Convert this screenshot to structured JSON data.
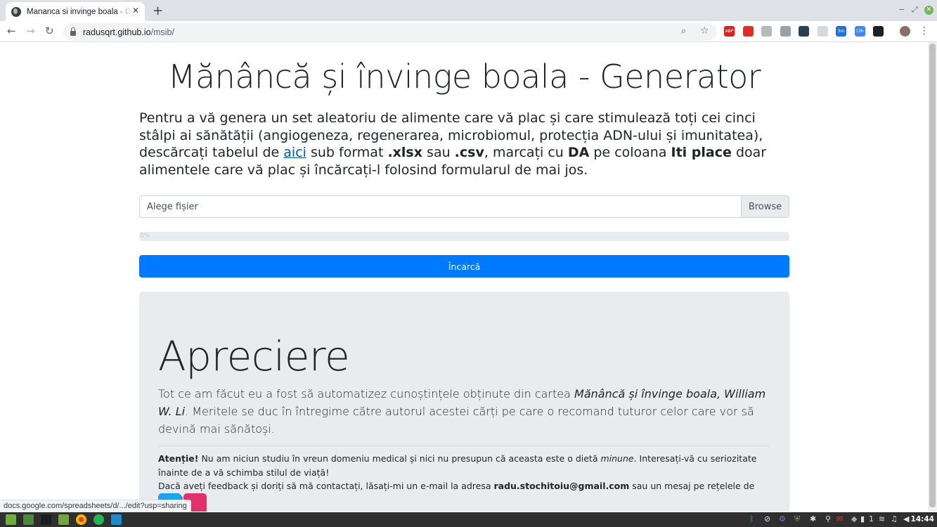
{
  "browser": {
    "tab_title": "Mananca si invinge boala - Generator",
    "tab_close": "✕",
    "new_tab": "+",
    "url_host": "radusqrt.github.io",
    "url_path": "/msib/",
    "back": "←",
    "forward": "→",
    "reload": "↻",
    "zoom_icon": "⌕",
    "star_icon": "☆",
    "menu_icon": "⋮",
    "win_minimize": "−",
    "win_restore": "⤢",
    "win_close": "✕",
    "extensions": [
      {
        "name": "adblock-plus-icon",
        "color": "#e0201f",
        "label": "ABP"
      },
      {
        "name": "youtube-icon",
        "color": "#e52d27",
        "label": ""
      },
      {
        "name": "extension-gray-icon",
        "color": "#b8b8b8",
        "label": ""
      },
      {
        "name": "cloud-icon",
        "color": "#9aa0a6",
        "label": ""
      },
      {
        "name": "extension-dark-icon",
        "color": "#2c3e50",
        "label": ""
      },
      {
        "name": "extension-light-icon",
        "color": "#d5d9dd",
        "label": ""
      },
      {
        "name": "timer-3m-icon",
        "color": "#1a73e8",
        "label": "3m"
      },
      {
        "name": "calendar-13h-icon",
        "color": "#4285f4",
        "label": "13h"
      },
      {
        "name": "notion-icon",
        "color": "#202124",
        "label": ""
      }
    ]
  },
  "page": {
    "title": "Mănâncă și învinge boala - Generator",
    "intro_1": "Pentru a vă genera un set aleatoriu de alimente care vă plac și care stimulează toți cei cinci stâlpi ai sănătății (angiogeneza, regenerarea, microbiomul, protecția ADN-ului și imunitatea), descărcați tabelul de ",
    "intro_link": "aici",
    "intro_2": " sub format ",
    "intro_xlsx": ".xlsx",
    "intro_3": " sau ",
    "intro_csv": ".csv",
    "intro_4": ", marcați cu ",
    "intro_da": "DA",
    "intro_5": " pe coloana ",
    "intro_col": "Iti place",
    "intro_6": " doar alimentele care vă plac și încărcați-l folosind formularul de mai jos.",
    "file_placeholder": "Alege fișier",
    "browse_label": "Browse",
    "progress_text": "0%",
    "progress_value": 0,
    "upload_label": "Încarcă",
    "appreciation": {
      "heading": "Apreciere",
      "lead_1": "Tot ce am făcut eu a fost să automatizez cunoștințele obținute din cartea ",
      "lead_book": "Mănâncă și învinge boala, William W. Li",
      "lead_2": ". Meritele se duc în întregime către autorul acestei cărți pe care o recomand tuturor celor care vor să devină mai sănătoși.",
      "warn_label": "Atenție!",
      "warn_1": " Nu am niciun studiu în vreun domeniu medical și nici nu presupun că aceasta este o dietă ",
      "warn_minune": "minune",
      "warn_2": ". Interesați-vă cu seriozitate înainte de a vă schimba stilul de viață!",
      "contact_1": "Dacă aveți feedback și doriți să mă contactați, lăsați-mi un e-mail la adresa ",
      "contact_email": "radu.stochitoiu@gmail.com",
      "contact_2": " sau un mesaj pe rețelele de socializare.",
      "social": [
        {
          "name": "twitter-icon",
          "color": "#1da1f2"
        },
        {
          "name": "instagram-icon",
          "color": "#e1306c"
        }
      ]
    },
    "status_url": "docs.google.com/spreadsheets/d/.../edit?usp=sharing"
  },
  "taskbar": {
    "apps": [
      {
        "name": "mint-menu-icon",
        "color": "#6fae3e"
      },
      {
        "name": "show-desktop-icon",
        "color": "#4a8a3a"
      },
      {
        "name": "terminal-icon",
        "color": "#1d1d1d"
      },
      {
        "name": "files-icon",
        "color": "#72a540"
      },
      {
        "name": "chrome-icon",
        "color": "#db4437"
      },
      {
        "name": "spotify-icon",
        "color": "#1db954"
      },
      {
        "name": "vscode-icon",
        "color": "#2489ca"
      }
    ],
    "tray_battery": "1",
    "clock": "14:44"
  }
}
